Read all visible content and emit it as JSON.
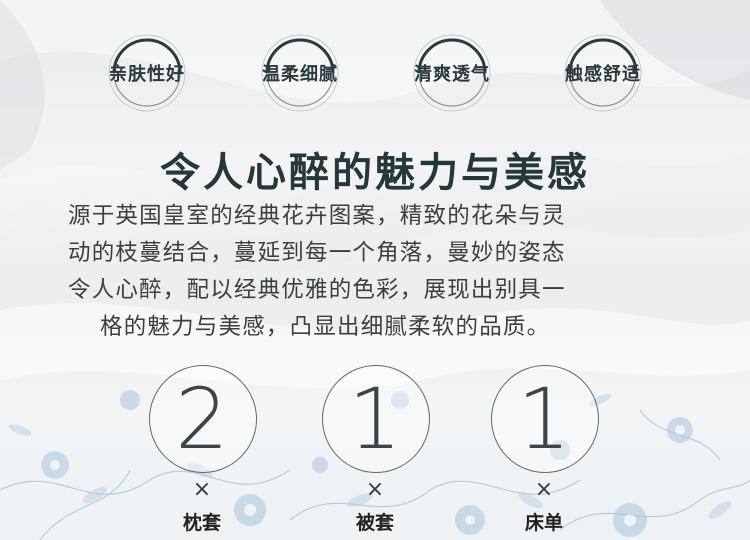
{
  "features": [
    {
      "label": "亲肤性好"
    },
    {
      "label": "温柔细腻"
    },
    {
      "label": "清爽透气"
    },
    {
      "label": "触感舒适"
    }
  ],
  "headline": "令人心醉的魅力与美感",
  "paragraph_lines": [
    "源于英国皇室的经典花卉图案，精致的花朵与灵",
    "动的枝蔓结合，蔓延到每一个角落，曼妙的姿态",
    "令人心醉，配以经典优雅的色彩，展现出别具一",
    "格的魅力与美感，凸显出细腻柔软的品质。"
  ],
  "items": [
    {
      "count": "2",
      "times": "×",
      "label": "枕套"
    },
    {
      "count": "1",
      "times": "×",
      "label": "被套"
    },
    {
      "count": "1",
      "times": "×",
      "label": "床单"
    }
  ],
  "colors": {
    "ring": "#5e6a6e",
    "ring_dark": "#2c3b3e",
    "heading": "#24373a",
    "floral": "#8fb0c8"
  }
}
